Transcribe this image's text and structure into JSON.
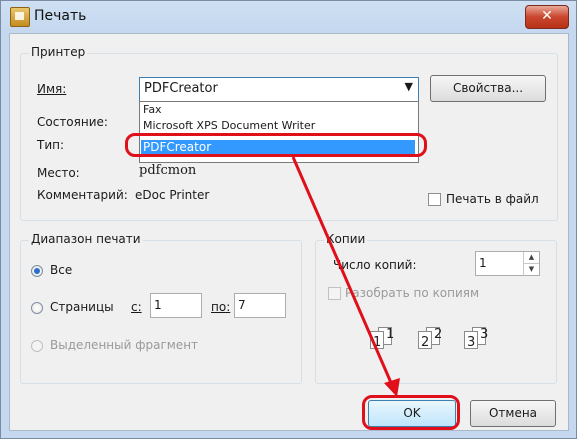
{
  "window": {
    "title": "Печать",
    "close_glyph": "✕"
  },
  "printer": {
    "legend": "Принтер",
    "name_label": "Имя:",
    "name_value": "PDFCreator",
    "properties_button": "Свойства...",
    "status_label": "Состояние:",
    "type_label": "Тип:",
    "where_label": "Место:",
    "where_value": "pdfcmon",
    "comment_label": "Комментарий:",
    "comment_value": "eDoc Printer",
    "print_to_file": "Печать в файл",
    "dropdown_options": [
      "Fax",
      "Microsoft XPS Document Writer",
      "PDFCreator"
    ]
  },
  "range": {
    "legend": "Диапазон печати",
    "all_label": "Все",
    "pages_label": "Страницы",
    "from_label": "с:",
    "from_value": "1",
    "to_label": "по:",
    "to_value": "7",
    "selection_label": "Выделенный фрагмент"
  },
  "copies": {
    "legend": "Копии",
    "count_label": "Число копий:",
    "count_value": "1",
    "collate_label": "Разобрать по копиям",
    "collate_pages": [
      "1",
      "1",
      "2",
      "2",
      "3",
      "3"
    ]
  },
  "buttons": {
    "ok": "OK",
    "cancel": "Отмена"
  },
  "colors": {
    "annotation": "#e0101a",
    "selection": "#3399ff"
  },
  "icons": {
    "close": "close-icon",
    "app": "printer-icon",
    "dropdown": "chevron-down-icon"
  }
}
